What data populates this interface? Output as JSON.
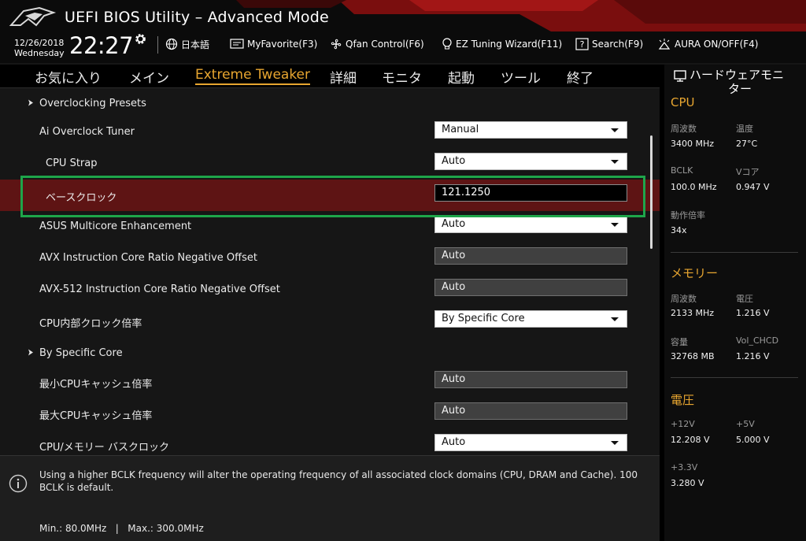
{
  "header": {
    "title": "UEFI BIOS Utility – Advanced Mode",
    "date": "12/26/2018",
    "weekday": "Wednesday",
    "time": "22:27",
    "items": [
      {
        "label": "日本語",
        "icon": "globe-icon"
      },
      {
        "label": "MyFavorite(F3)",
        "icon": "favorite-icon"
      },
      {
        "label": "Qfan Control(F6)",
        "icon": "fan-icon"
      },
      {
        "label": "EZ Tuning Wizard(F11)",
        "icon": "bulb-icon"
      },
      {
        "label": "Search(F9)",
        "icon": "search-icon"
      },
      {
        "label": "AURA ON/OFF(F4)",
        "icon": "aura-icon"
      }
    ]
  },
  "tabs": [
    {
      "label": "お気に入り",
      "active": false
    },
    {
      "label": "メイン",
      "active": false
    },
    {
      "label": "Extreme Tweaker",
      "active": true
    },
    {
      "label": "詳細",
      "active": false
    },
    {
      "label": "モニタ",
      "active": false
    },
    {
      "label": "起動",
      "active": false
    },
    {
      "label": "ツール",
      "active": false
    },
    {
      "label": "終了",
      "active": false
    }
  ],
  "settings": [
    {
      "label": "Overclocking Presets",
      "type": "submenu"
    },
    {
      "label": "Ai Overclock Tuner",
      "type": "dropdown",
      "value": "Manual"
    },
    {
      "label": "CPU Strap",
      "type": "dropdown",
      "value": "Auto"
    },
    {
      "label": "ベースクロック",
      "type": "input",
      "value": "121.1250",
      "selected": true
    },
    {
      "label": "ASUS Multicore Enhancement",
      "type": "dropdown",
      "value": "Auto"
    },
    {
      "label": "AVX Instruction Core Ratio Negative Offset",
      "type": "readonly",
      "value": "Auto"
    },
    {
      "label": "AVX-512 Instruction Core Ratio Negative Offset",
      "type": "readonly",
      "value": "Auto"
    },
    {
      "label": "CPU内部クロック倍率",
      "type": "dropdown",
      "value": "By Specific Core"
    },
    {
      "label": "By Specific Core",
      "type": "submenu"
    },
    {
      "label": "最小CPUキャッシュ倍率",
      "type": "readonly",
      "value": "Auto"
    },
    {
      "label": "最大CPUキャッシュ倍率",
      "type": "readonly",
      "value": "Auto"
    },
    {
      "label": "CPU/メモリー バスクロック",
      "type": "dropdown",
      "value": "Auto"
    }
  ],
  "help": {
    "text": "Using a higher BCLK frequency will alter the operating frequency of all associated clock domains (CPU, DRAM and Cache). 100 BCLK is default.",
    "range": "Min.: 80.0MHz   |   Max.: 300.0MHz"
  },
  "monitor": {
    "title_line1": "ハードウェアモニ",
    "title_line2": "ター",
    "cpu": {
      "title": "CPU",
      "freq_label": "周波数",
      "freq_value": "3400 MHz",
      "temp_label": "温度",
      "temp_value": "27°C",
      "bclk_label": "BCLK",
      "bclk_value": "100.0 MHz",
      "vcore_label": "Vコア",
      "vcore_value": "0.947 V",
      "ratio_label": "動作倍率",
      "ratio_value": "34x"
    },
    "memory": {
      "title": "メモリー",
      "freq_label": "周波数",
      "freq_value": "2133 MHz",
      "volt_label": "電圧",
      "volt_value": "1.216 V",
      "cap_label": "容量",
      "cap_value": "32768 MB",
      "chcd_label": "Vol_CHCD",
      "chcd_value": "1.216 V"
    },
    "voltage": {
      "title": "電圧",
      "v12_label": "+12V",
      "v12_value": "12.208 V",
      "v5_label": "+5V",
      "v5_value": "5.000 V",
      "v33_label": "+3.3V",
      "v33_value": "3.280 V"
    }
  },
  "colors": {
    "accent": "#e8a630",
    "selected_row": "#5e1414",
    "highlight_box": "#1ea54a",
    "header_red": "#8a1010"
  }
}
